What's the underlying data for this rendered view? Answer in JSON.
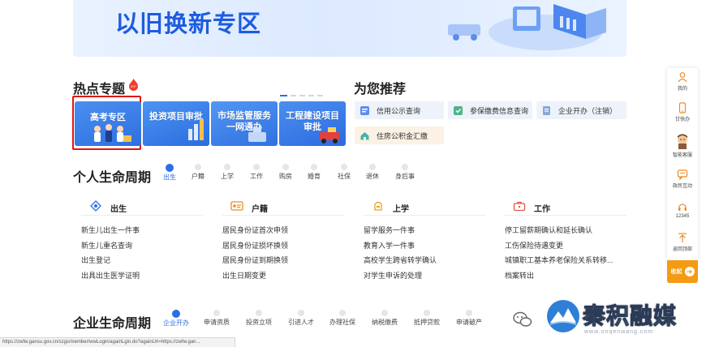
{
  "banner": {
    "title": "以旧换新专区"
  },
  "hot": {
    "title": "热点专题",
    "badge": "HOT"
  },
  "recommend": {
    "title": "为您推荐"
  },
  "topics": [
    {
      "label": "高考专区"
    },
    {
      "label": "投资项目审批"
    },
    {
      "label": "市场监管服务一网通办"
    },
    {
      "label": "工程建设项目审批"
    }
  ],
  "recommend_items": [
    {
      "label": "信用公示查询"
    },
    {
      "label": "参保缴费信息查询"
    },
    {
      "label": "企业开办（注销）"
    },
    {
      "label": "住房公积金汇缴"
    }
  ],
  "personal": {
    "title": "个人生命周期",
    "tabs": [
      "出生",
      "户籍",
      "上学",
      "工作",
      "购房",
      "婚育",
      "社保",
      "退休",
      "身后事"
    ],
    "active_tab": "出生"
  },
  "columns": [
    {
      "title": "出生",
      "links": [
        "新生儿出生一件事",
        "新生儿重名查询",
        "出生登记",
        "出具出生医学证明"
      ]
    },
    {
      "title": "户籍",
      "links": [
        "居民身份证首次申领",
        "居民身份证损坏换领",
        "居民身份证到期换领",
        "出生日期变更"
      ]
    },
    {
      "title": "上学",
      "links": [
        "留学服务一件事",
        "教育入学一件事",
        "高校学生跨省转学确认",
        "对学生申诉的处理"
      ]
    },
    {
      "title": "工作",
      "links": [
        "停工留薪期确认和延长确认",
        "工伤保险待遇变更",
        "城镇职工基本养老保险关系转移...",
        "档案转出"
      ]
    }
  ],
  "enterprise": {
    "title": "企业生命周期",
    "tabs": [
      "企业开办",
      "申请资质",
      "投资立项",
      "引进人才",
      "办理社保",
      "纳税缴费",
      "抵押贷款",
      "申请破产"
    ],
    "active_tab": "企业开办"
  },
  "float_bar": {
    "items": [
      {
        "label": "我的",
        "icon": "user-icon"
      },
      {
        "label": "甘快办",
        "icon": "phone-icon"
      },
      {
        "label": "智能客服",
        "icon": "robot-avatar-icon"
      },
      {
        "label": "政民互动",
        "icon": "chat-icon"
      },
      {
        "label": "12345",
        "icon": "hotline-icon"
      },
      {
        "label": "返回顶部",
        "icon": "arrow-up-icon"
      }
    ],
    "collapse_label": "收起"
  },
  "status_url": "https://zwfw.gansu.gov.cn/szgs/member/wwLogin/againLgin.do?againUrl=https://zwfw.gan...",
  "watermark": {
    "text": "秦积融媒",
    "sub": "www.onqenwang.com"
  },
  "colors": {
    "accent": "#2b6fe6",
    "highlight": "#e01515",
    "cta": "#f59a13"
  }
}
